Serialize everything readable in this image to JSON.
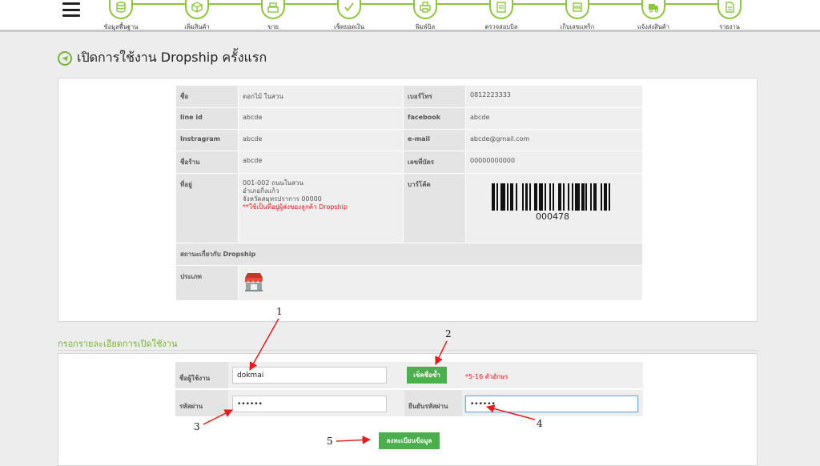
{
  "nav": {
    "steps": [
      {
        "label": "ข้อมูลพื้นฐาน",
        "icon": "database-icon"
      },
      {
        "label": "เพิ่มสินค้า",
        "icon": "box-icon"
      },
      {
        "label": "ขาย",
        "icon": "cash-register-icon"
      },
      {
        "label": "เช็คยอดเงิน",
        "icon": "money-check-icon"
      },
      {
        "label": "พิมพ์บิล",
        "icon": "printer-icon"
      },
      {
        "label": "ตรวจสอบบิล",
        "icon": "bill-check-icon"
      },
      {
        "label": "เก็บเลขแทร็ก",
        "icon": "tracking-icon"
      },
      {
        "label": "แจ้งส่งสินค้า",
        "icon": "truck-icon"
      },
      {
        "label": "รายงาน",
        "icon": "report-icon"
      }
    ]
  },
  "page": {
    "title": "เปิดการใช้งาน Dropship ครั้งแรก"
  },
  "info": {
    "name_label": "ชื่อ",
    "name": "ดอกไม้ ในสวน",
    "phone_label": "เบอร์โทร",
    "phone": "0812223333",
    "lineid_label": "line id",
    "lineid": "abcde",
    "facebook_label": "facebook",
    "facebook": "abcde",
    "instagram_label": "Instragram",
    "instagram": "abcde",
    "email_label": "e-mail",
    "email": "abcde@gmail.com",
    "shop_label": "ชื่อร้าน",
    "shop": "abcde",
    "card_label": "เลขที่บัตร",
    "card": "00000000000",
    "address_label": "ที่อยู่",
    "address_lines": [
      "001-002 ถนนในสวน",
      "อำเภอกิ่งแก้ว",
      "จังหวัดสมุทรปราการ 00000"
    ],
    "address_note": "**ใช้เป็นที่อยู่ผู้ส่งของลูกค้า Dropship",
    "barcode_label": "บาร์โค้ด",
    "barcode_number": "000478",
    "status_head": "สถานะเกี่ยวกับ Dropship",
    "type_label": "ประเภท"
  },
  "form": {
    "section_title": "กรอกรายละเอียดการเปิดใช้งาน",
    "username_label": "ชื่อผู้ใช้งาน",
    "username_value": "dokmai",
    "check_button": "เช็คชื่อซ้ำ",
    "username_hint": "*5-16 ตัวอักษร",
    "password_label": "รหัสผ่าน",
    "password_value": "••••••",
    "confirm_label": "ยืนยันรหัสผ่าน",
    "confirm_value": "••••••",
    "submit_button": "ลงทะเบียนข้อมูล"
  },
  "annotations": {
    "n1": "1",
    "n2": "2",
    "n3": "3",
    "n4": "4",
    "n5": "5",
    "color": "#e02020"
  },
  "colors": {
    "accent_green": "#8cc63e",
    "button_green": "#4cae4c",
    "warning_red": "#e11111"
  }
}
